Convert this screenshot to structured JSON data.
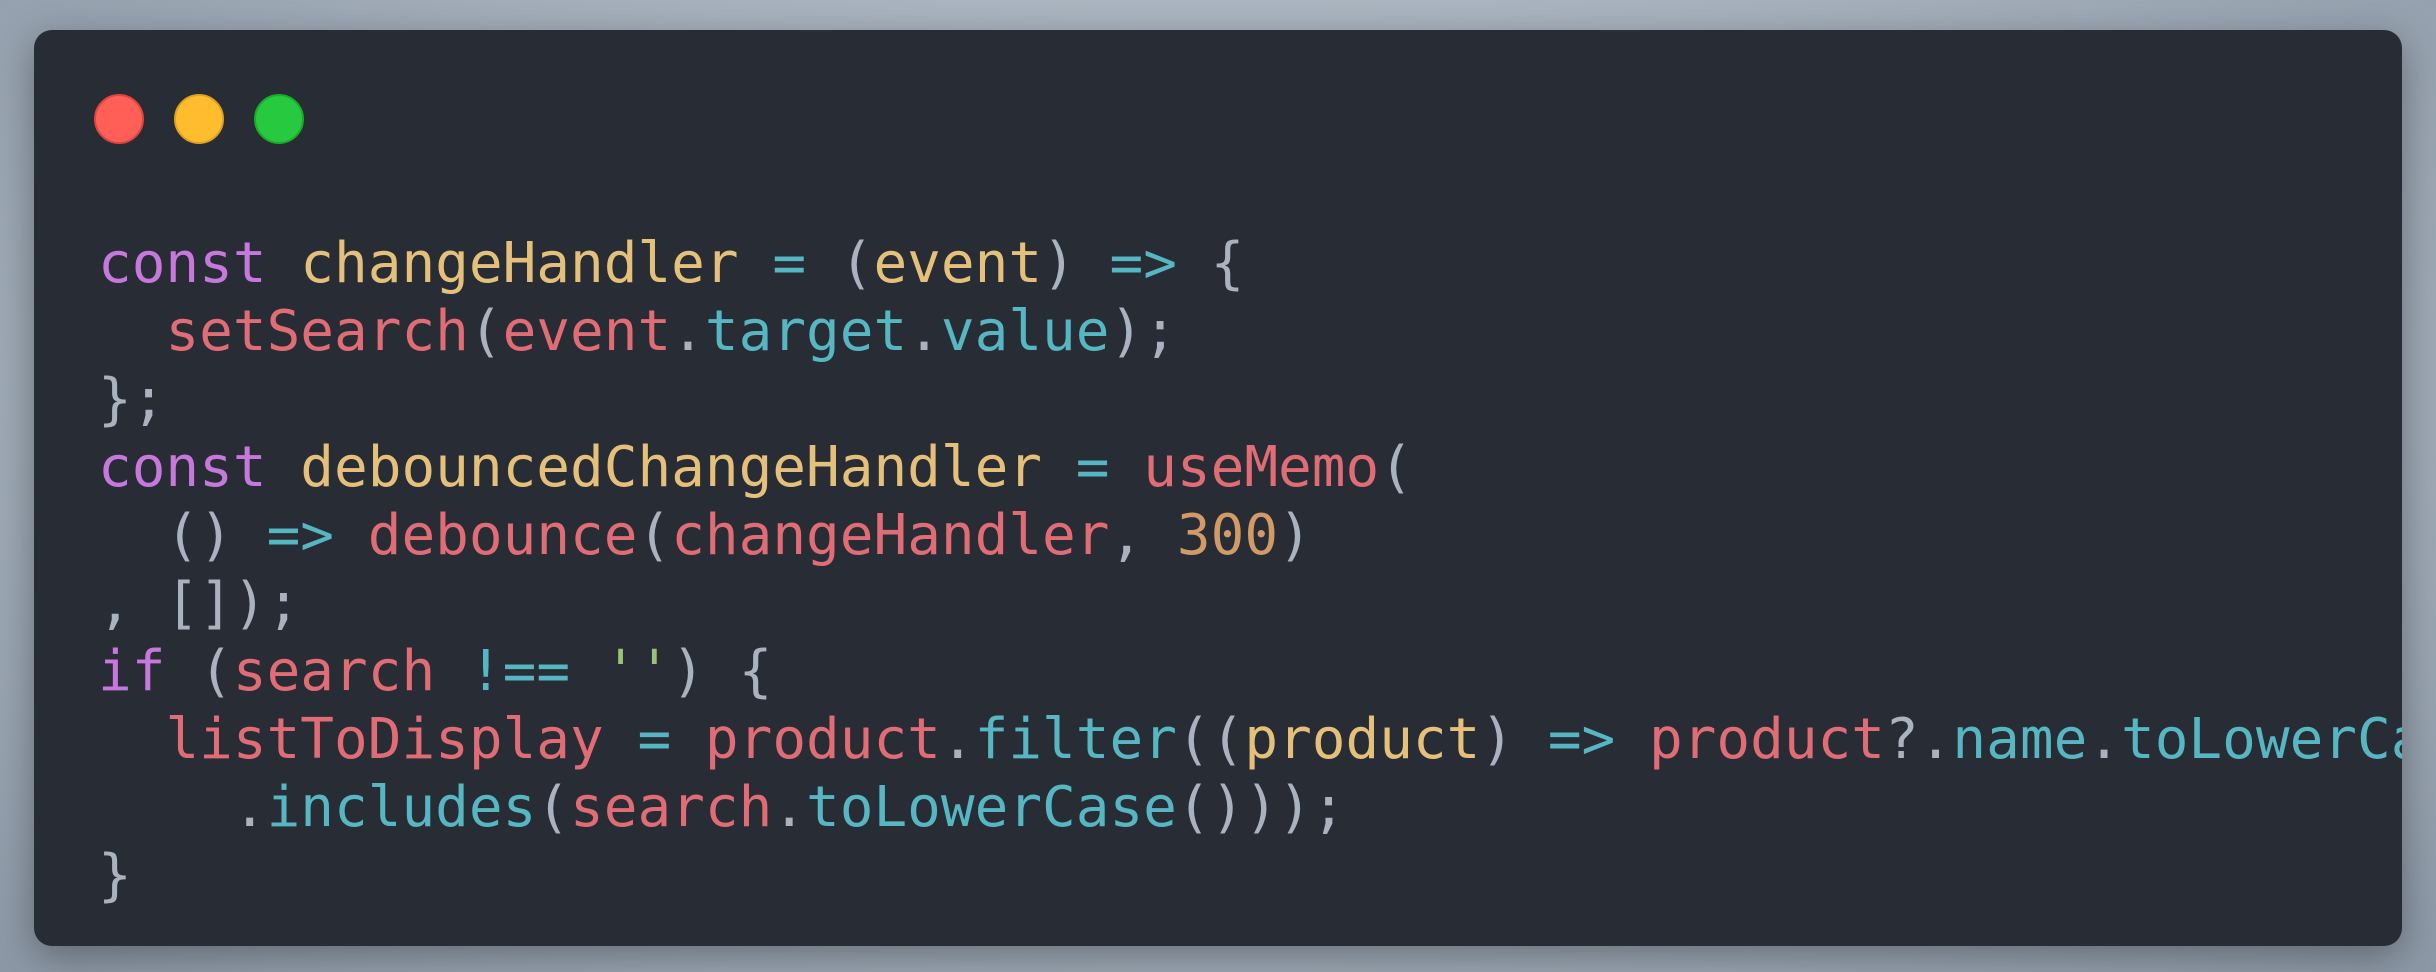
{
  "window": {
    "controls": [
      {
        "name": "close",
        "color": "#ff5f56",
        "border": "#e0443e"
      },
      {
        "name": "minimize",
        "color": "#ffbd2e",
        "border": "#dea123"
      },
      {
        "name": "maximize",
        "color": "#27c93f",
        "border": "#1aab29"
      }
    ]
  },
  "code": {
    "language": "javascript",
    "lines": [
      [
        {
          "t": "const",
          "k": "keyword"
        },
        {
          "t": " ",
          "k": "plain"
        },
        {
          "t": "changeHandler",
          "k": "variable"
        },
        {
          "t": " ",
          "k": "plain"
        },
        {
          "t": "=",
          "k": "operator"
        },
        {
          "t": " ",
          "k": "plain"
        },
        {
          "t": "(",
          "k": "punct"
        },
        {
          "t": "event",
          "k": "param"
        },
        {
          "t": ")",
          "k": "punct"
        },
        {
          "t": " ",
          "k": "plain"
        },
        {
          "t": "=>",
          "k": "operator"
        },
        {
          "t": " ",
          "k": "plain"
        },
        {
          "t": "{",
          "k": "punct"
        }
      ],
      [
        {
          "t": "  ",
          "k": "plain"
        },
        {
          "t": "setSearch",
          "k": "call"
        },
        {
          "t": "(",
          "k": "punct"
        },
        {
          "t": "event",
          "k": "call"
        },
        {
          "t": ".",
          "k": "punct"
        },
        {
          "t": "target",
          "k": "property"
        },
        {
          "t": ".",
          "k": "punct"
        },
        {
          "t": "value",
          "k": "property"
        },
        {
          "t": ");",
          "k": "punct"
        }
      ],
      [
        {
          "t": "};",
          "k": "punct"
        }
      ],
      [
        {
          "t": "const",
          "k": "keyword"
        },
        {
          "t": " ",
          "k": "plain"
        },
        {
          "t": "debouncedChangeHandler",
          "k": "variable"
        },
        {
          "t": " ",
          "k": "plain"
        },
        {
          "t": "=",
          "k": "operator"
        },
        {
          "t": " ",
          "k": "plain"
        },
        {
          "t": "useMemo",
          "k": "call"
        },
        {
          "t": "(",
          "k": "punct"
        }
      ],
      [
        {
          "t": "  ",
          "k": "plain"
        },
        {
          "t": "()",
          "k": "punct"
        },
        {
          "t": " ",
          "k": "plain"
        },
        {
          "t": "=>",
          "k": "operator"
        },
        {
          "t": " ",
          "k": "plain"
        },
        {
          "t": "debounce",
          "k": "call"
        },
        {
          "t": "(",
          "k": "punct"
        },
        {
          "t": "changeHandler",
          "k": "call"
        },
        {
          "t": ",",
          "k": "punct"
        },
        {
          "t": " ",
          "k": "plain"
        },
        {
          "t": "300",
          "k": "number"
        },
        {
          "t": ")",
          "k": "punct"
        }
      ],
      [
        {
          "t": ", []);",
          "k": "punct"
        }
      ],
      [
        {
          "t": "if",
          "k": "keyword"
        },
        {
          "t": " ",
          "k": "plain"
        },
        {
          "t": "(",
          "k": "punct"
        },
        {
          "t": "search",
          "k": "call"
        },
        {
          "t": " ",
          "k": "plain"
        },
        {
          "t": "!==",
          "k": "operator"
        },
        {
          "t": " ",
          "k": "plain"
        },
        {
          "t": "''",
          "k": "string"
        },
        {
          "t": ")",
          "k": "punct"
        },
        {
          "t": " ",
          "k": "plain"
        },
        {
          "t": "{",
          "k": "punct"
        }
      ],
      [
        {
          "t": "  ",
          "k": "plain"
        },
        {
          "t": "listToDisplay",
          "k": "call"
        },
        {
          "t": " ",
          "k": "plain"
        },
        {
          "t": "=",
          "k": "operator"
        },
        {
          "t": " ",
          "k": "plain"
        },
        {
          "t": "product",
          "k": "call"
        },
        {
          "t": ".",
          "k": "punct"
        },
        {
          "t": "filter",
          "k": "property"
        },
        {
          "t": "((",
          "k": "punct"
        },
        {
          "t": "product",
          "k": "param"
        },
        {
          "t": ")",
          "k": "punct"
        },
        {
          "t": " ",
          "k": "plain"
        },
        {
          "t": "=>",
          "k": "operator"
        },
        {
          "t": " ",
          "k": "plain"
        },
        {
          "t": "product",
          "k": "call"
        },
        {
          "t": "?.",
          "k": "punct"
        },
        {
          "t": "name",
          "k": "property"
        },
        {
          "t": ".",
          "k": "punct"
        },
        {
          "t": "toLowerCase",
          "k": "property"
        },
        {
          "t": "()",
          "k": "punct"
        }
      ],
      [
        {
          "t": "    ",
          "k": "plain"
        },
        {
          "t": ".",
          "k": "punct"
        },
        {
          "t": "includes",
          "k": "property"
        },
        {
          "t": "(",
          "k": "punct"
        },
        {
          "t": "search",
          "k": "call"
        },
        {
          "t": ".",
          "k": "punct"
        },
        {
          "t": "toLowerCase",
          "k": "property"
        },
        {
          "t": "()));",
          "k": "punct"
        }
      ],
      [
        {
          "t": "}",
          "k": "punct"
        }
      ]
    ]
  }
}
